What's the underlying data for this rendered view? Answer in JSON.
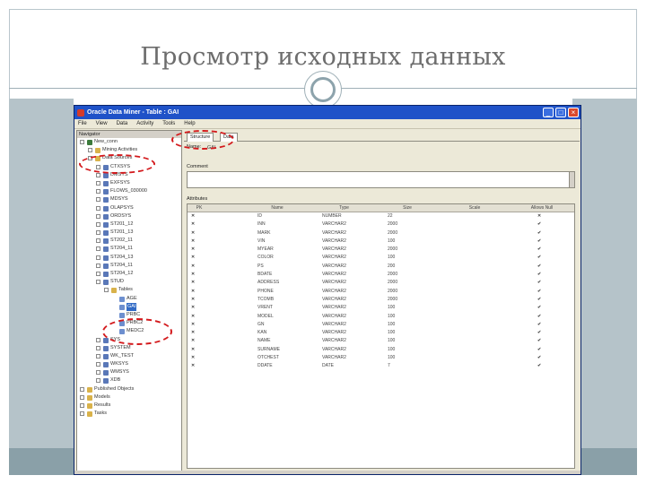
{
  "slide": {
    "title": "Просмотр исходных данных"
  },
  "window": {
    "title": "Oracle Data Miner - Table : GAI",
    "controls": {
      "minimize": "_",
      "maximize": "□",
      "close": "×"
    }
  },
  "menu": [
    "File",
    "View",
    "Data",
    "Activity",
    "Tools",
    "Help"
  ],
  "navigator": {
    "header": "Navigator",
    "nodes": [
      {
        "label": "New_conn",
        "level": 0,
        "expander": "-",
        "icon": "connection"
      },
      {
        "label": "Mining Activities",
        "level": 1,
        "expander": "+",
        "icon": "folder"
      },
      {
        "label": "Data Sources",
        "level": 1,
        "expander": "-",
        "icon": "folder"
      },
      {
        "label": "CTXSYS",
        "level": 2,
        "expander": "+",
        "icon": "schema"
      },
      {
        "label": "DMSYS",
        "level": 2,
        "expander": "+",
        "icon": "schema"
      },
      {
        "label": "EXFSYS",
        "level": 2,
        "expander": "+",
        "icon": "schema"
      },
      {
        "label": "FLOWS_030000",
        "level": 2,
        "expander": "+",
        "icon": "schema"
      },
      {
        "label": "MDSYS",
        "level": 2,
        "expander": "+",
        "icon": "schema"
      },
      {
        "label": "OLAPSYS",
        "level": 2,
        "expander": "+",
        "icon": "schema"
      },
      {
        "label": "ORDSYS",
        "level": 2,
        "expander": "+",
        "icon": "schema"
      },
      {
        "label": "ST201_12",
        "level": 2,
        "expander": "+",
        "icon": "schema"
      },
      {
        "label": "ST201_13",
        "level": 2,
        "expander": "+",
        "icon": "schema"
      },
      {
        "label": "ST202_11",
        "level": 2,
        "expander": "+",
        "icon": "schema"
      },
      {
        "label": "ST204_11",
        "level": 2,
        "expander": "+",
        "icon": "schema"
      },
      {
        "label": "ST204_13",
        "level": 2,
        "expander": "+",
        "icon": "schema"
      },
      {
        "label": "ST204_11",
        "level": 2,
        "expander": "+",
        "icon": "schema"
      },
      {
        "label": "ST204_12",
        "level": 2,
        "expander": "+",
        "icon": "schema"
      },
      {
        "label": "STUD",
        "level": 2,
        "expander": "-",
        "icon": "schema"
      },
      {
        "label": "Tables",
        "level": 3,
        "expander": "-",
        "icon": "folder"
      },
      {
        "label": "AGE",
        "level": 4,
        "expander": "",
        "icon": "table"
      },
      {
        "label": "GAI",
        "level": 4,
        "expander": "",
        "icon": "table",
        "selected": true
      },
      {
        "label": "PRBC",
        "level": 4,
        "expander": "",
        "icon": "table"
      },
      {
        "label": "PRBC2",
        "level": 4,
        "expander": "",
        "icon": "table"
      },
      {
        "label": "MEDC2",
        "level": 4,
        "expander": "",
        "icon": "table"
      },
      {
        "label": "SYS",
        "level": 2,
        "expander": "+",
        "icon": "schema"
      },
      {
        "label": "SYSTEM",
        "level": 2,
        "expander": "+",
        "icon": "schema"
      },
      {
        "label": "WK_TEST",
        "level": 2,
        "expander": "+",
        "icon": "schema"
      },
      {
        "label": "WKSYS",
        "level": 2,
        "expander": "+",
        "icon": "schema"
      },
      {
        "label": "WMSYS",
        "level": 2,
        "expander": "+",
        "icon": "schema"
      },
      {
        "label": "XDB",
        "level": 2,
        "expander": "+",
        "icon": "schema"
      },
      {
        "label": "Published Objects",
        "level": 0,
        "expander": "+",
        "icon": "folder"
      },
      {
        "label": "Models",
        "level": 0,
        "expander": "+",
        "icon": "folder"
      },
      {
        "label": "Results",
        "level": 0,
        "expander": "+",
        "icon": "folder"
      },
      {
        "label": "Tasks",
        "level": 0,
        "expander": "+",
        "icon": "folder"
      }
    ]
  },
  "panel": {
    "tabs": [
      "Structure",
      "Data"
    ],
    "name_label": "Name:",
    "name_value": "GAI",
    "comment_label": "Comment",
    "attributes_label": "Attributes",
    "columns": [
      "PK",
      "Name",
      "Type",
      "Size",
      "Scale",
      "Allows Null"
    ],
    "rows": [
      {
        "pk": true,
        "name": "ID",
        "type": "NUMBER",
        "size": "22",
        "allows_null": false
      },
      {
        "pk": false,
        "name": "INN",
        "type": "VARCHAR2",
        "size": "2000",
        "allows_null": true
      },
      {
        "pk": false,
        "name": "MARK",
        "type": "VARCHAR2",
        "size": "2000",
        "allows_null": true
      },
      {
        "pk": false,
        "name": "VIN",
        "type": "VARCHAR2",
        "size": "100",
        "allows_null": true
      },
      {
        "pk": false,
        "name": "MYEAR",
        "type": "VARCHAR2",
        "size": "2000",
        "allows_null": true
      },
      {
        "pk": false,
        "name": "COLOR",
        "type": "VARCHAR2",
        "size": "100",
        "allows_null": true
      },
      {
        "pk": false,
        "name": "PS",
        "type": "VARCHAR2",
        "size": "200",
        "allows_null": true
      },
      {
        "pk": false,
        "name": "BDATE",
        "type": "VARCHAR2",
        "size": "2000",
        "allows_null": true
      },
      {
        "pk": false,
        "name": "ADDRESS",
        "type": "VARCHAR2",
        "size": "2000",
        "allows_null": true
      },
      {
        "pk": false,
        "name": "PHONE",
        "type": "VARCHAR2",
        "size": "2000",
        "allows_null": true
      },
      {
        "pk": false,
        "name": "TCOMB",
        "type": "VARCHAR2",
        "size": "2000",
        "allows_null": true
      },
      {
        "pk": false,
        "name": "VRENT",
        "type": "VARCHAR2",
        "size": "100",
        "allows_null": true
      },
      {
        "pk": false,
        "name": "MODEL",
        "type": "VARCHAR2",
        "size": "100",
        "allows_null": true
      },
      {
        "pk": false,
        "name": "GN",
        "type": "VARCHAR2",
        "size": "100",
        "allows_null": true
      },
      {
        "pk": false,
        "name": "KAN",
        "type": "VARCHAR2",
        "size": "100",
        "allows_null": true
      },
      {
        "pk": false,
        "name": "NAME",
        "type": "VARCHAR2",
        "size": "100",
        "allows_null": true
      },
      {
        "pk": false,
        "name": "SURNAME",
        "type": "VARCHAR2",
        "size": "100",
        "allows_null": true
      },
      {
        "pk": false,
        "name": "OTCHEST",
        "type": "VARCHAR2",
        "size": "100",
        "allows_null": true
      },
      {
        "pk": false,
        "name": "DDATE",
        "type": "DATE",
        "size": "7",
        "allows_null": true
      }
    ]
  },
  "colors": {
    "titlebar": "#1f52c8",
    "highlight": "#d3191c",
    "selection": "#316ac5",
    "slide_band": "#b5c3c9"
  }
}
